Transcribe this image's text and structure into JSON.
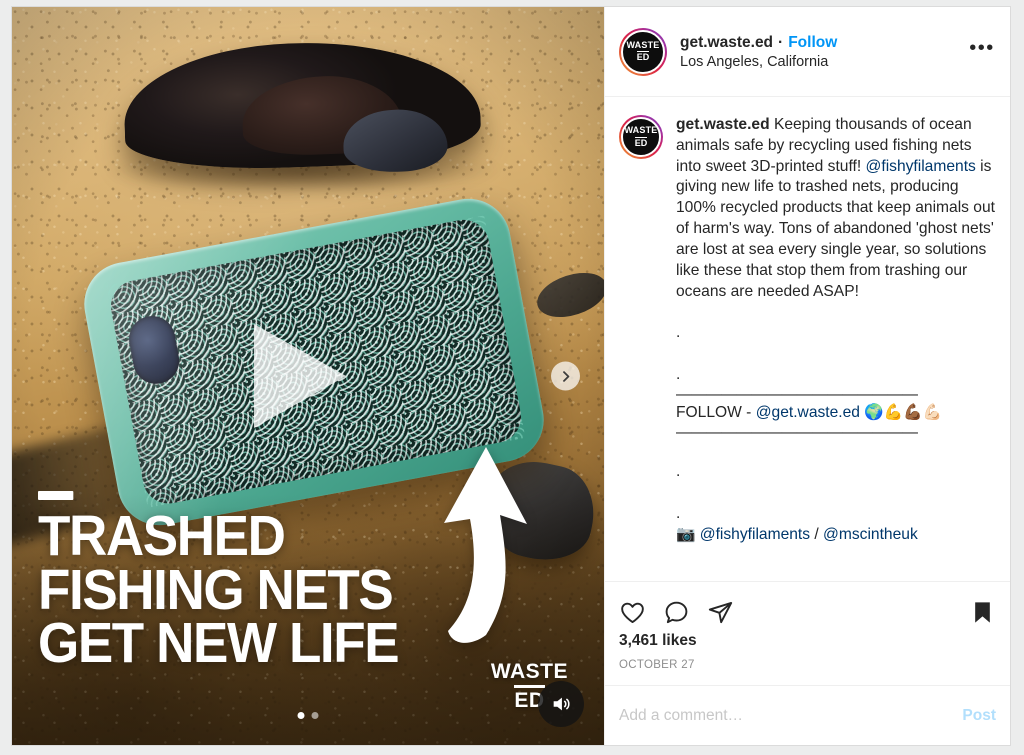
{
  "post": {
    "header": {
      "avatar": {
        "line1": "WASTE",
        "line2": "ED"
      },
      "username": "get.waste.ed",
      "separator": "·",
      "follow_label": "Follow",
      "location": "Los Angeles, California",
      "more_label": "•••"
    },
    "media": {
      "headline_line1": "TRASHED",
      "headline_line2": "FISHING NETS",
      "headline_line3": "GET NEW LIFE",
      "watermark_line1": "WASTE",
      "watermark_line2": "ED",
      "carousel": {
        "total": 2,
        "active_index": 0
      },
      "play_button_label": "Play",
      "next_button_label": "Next",
      "audio_button_label": "Audio on"
    },
    "caption": {
      "username": "get.waste.ed",
      "text_part1": "Keeping thousands of ocean animals safe by recycling used fishing nets into sweet 3D-printed stuff! ",
      "mention1": "@fishyfilaments",
      "text_part2": " is giving new life to trashed nets, producing 100% recycled products that keep animals out of harm's way. Tons of abandoned 'ghost nets' are lost at sea every single year, so solutions like these that stop them from trashing our oceans are needed ASAP!",
      "dot": ".",
      "rule": "————————————————",
      "follow_prefix": "FOLLOW - ",
      "follow_handle": "@get.waste.ed",
      "follow_emoji": " 🌍💪💪🏾💪🏻",
      "credit_emoji": "📷 ",
      "credit_mention1": "@fishyfilaments",
      "credit_divider": " / ",
      "credit_mention2": "@mscintheuk"
    },
    "actions": {
      "like_label": "Like",
      "comment_label": "Comment",
      "share_label": "Share",
      "save_label": "Save",
      "likes_count": "3,461 likes",
      "timestamp": "OCTOBER 27"
    },
    "comment_bar": {
      "placeholder": "Add a comment…",
      "post_label": "Post"
    }
  },
  "colors": {
    "accent_blue": "#0095f6",
    "mention_blue": "#00376b",
    "post_blue_disabled": "#b2dffc",
    "text_primary": "#262626",
    "text_muted": "#8e8e8e",
    "border": "#efefef",
    "page_bg": "#eceded",
    "case_teal": "#63b9a2"
  }
}
